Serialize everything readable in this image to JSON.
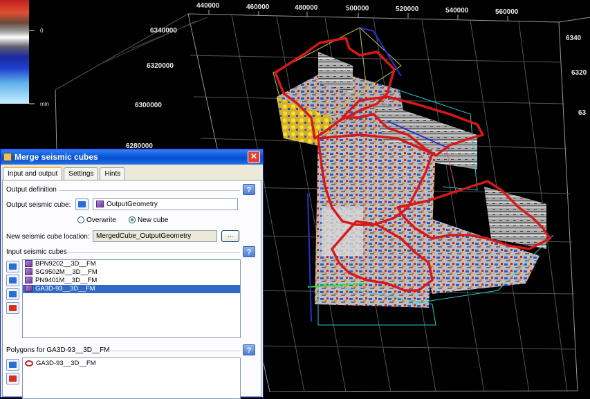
{
  "viewport": {
    "top_axis_ticks": [
      "440000",
      "460000",
      "480000",
      "500000",
      "520000",
      "540000",
      "560000"
    ],
    "left_axis_ticks": [
      "6340000",
      "6320000",
      "6300000",
      "6280000"
    ],
    "right_axis_ticks": [
      "6340",
      "6320",
      "63"
    ],
    "colorbar": {
      "zero_label": "0",
      "min_label": "min"
    },
    "colors": {
      "polygon": "#d81818",
      "axis_line": "#cccccc"
    }
  },
  "dialog": {
    "title": "Merge seismic cubes",
    "close_symbol": "✕",
    "tabs": [
      "Input and output",
      "Settings",
      "Hints"
    ],
    "output_definition_label": "Output definition",
    "output_cube_label": "Output seismic cube:",
    "output_cube_value": "OutputGeometry",
    "radio_overwrite": "Overwrite",
    "radio_new_cube": "New cube",
    "new_location_label": "New seismic cube location:",
    "new_location_value": "MergedCube_OutputGeometry",
    "browse_label": "...",
    "input_cubes_label": "Input seismic cubes",
    "input_cubes": [
      "BPN9202__3D__FM",
      "SG9502M__3D__FM",
      "PN9401M__3D__FM",
      "GA3D-93__3D__FM"
    ],
    "polygons_label": "Polygons for GA3D-93__3D__FM",
    "polygons": [
      "GA3D-93__3D__FM"
    ],
    "help_symbol": "?"
  }
}
